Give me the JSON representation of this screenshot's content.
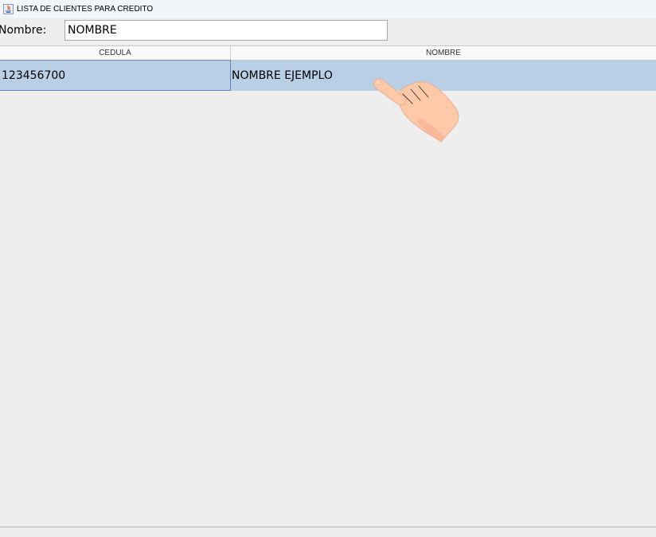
{
  "window": {
    "title": "LISTA DE CLIENTES PARA CREDITO",
    "icon": "java-icon"
  },
  "filter": {
    "label": "Nombre:",
    "value": "NOMBRE"
  },
  "table": {
    "columns": [
      "CEDULA",
      "NOMBRE"
    ],
    "rows": [
      {
        "cedula": "123456700",
        "nombre": "NOMBRE EJEMPLO",
        "selected": true
      }
    ]
  },
  "overlay": {
    "icon": "pointing-hand-icon"
  },
  "colors": {
    "selection": "#b8cfe5",
    "background": "#eeeeee",
    "skin": "#ffc8a8"
  }
}
